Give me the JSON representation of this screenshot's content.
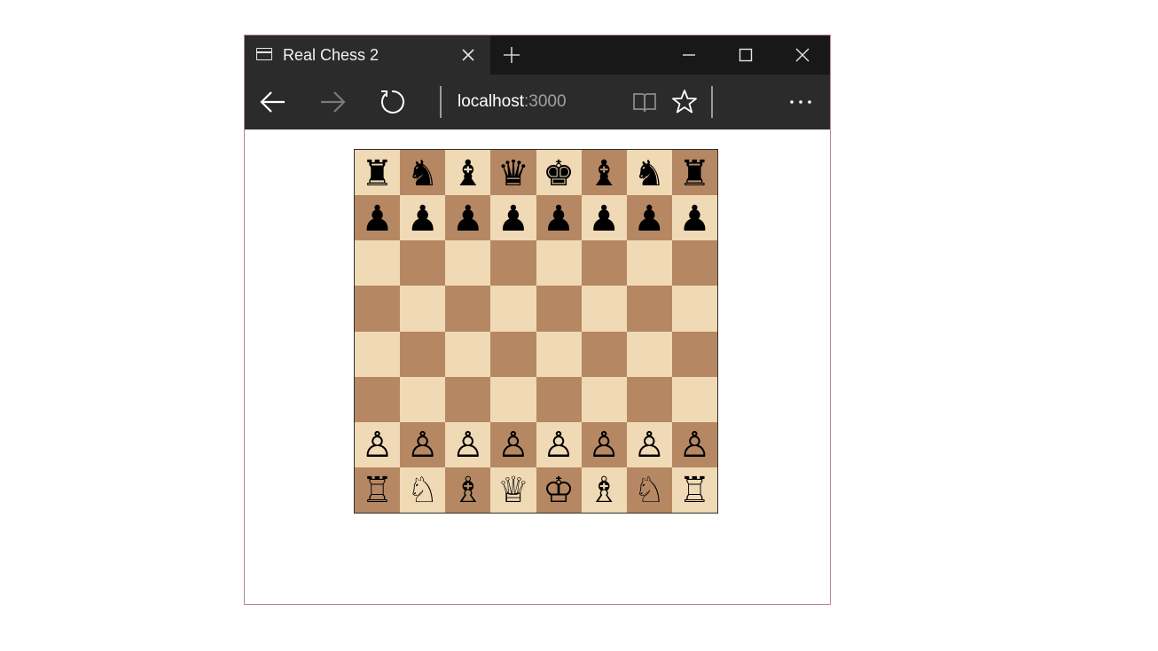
{
  "browser": {
    "tab_title": "Real Chess 2",
    "address_host": "localhost",
    "address_port": ":3000",
    "icons": {
      "tab": "tab-page-icon",
      "tab_close": "close-icon",
      "new_tab": "plus-icon",
      "minimize": "minimize-icon",
      "maximize": "maximize-icon",
      "close": "close-icon",
      "back": "arrow-left-icon",
      "forward": "arrow-right-icon",
      "refresh": "refresh-icon",
      "reading_view": "book-icon",
      "favorite": "star-icon",
      "more": "more-icon"
    },
    "colors": {
      "titlebar": "#181818",
      "toolbar": "#2b2b2b",
      "window_border": "#b9868a"
    }
  },
  "board": {
    "light_color": "#f0d9b5",
    "dark_color": "#b58863",
    "ranks": [
      [
        "♜",
        "♞",
        "♝",
        "♛",
        "♚",
        "♝",
        "♞",
        "♜"
      ],
      [
        "♟",
        "♟",
        "♟",
        "♟",
        "♟",
        "♟",
        "♟",
        "♟"
      ],
      [
        "",
        "",
        "",
        "",
        "",
        "",
        "",
        ""
      ],
      [
        "",
        "",
        "",
        "",
        "",
        "",
        "",
        ""
      ],
      [
        "",
        "",
        "",
        "",
        "",
        "",
        "",
        ""
      ],
      [
        "",
        "",
        "",
        "",
        "",
        "",
        "",
        ""
      ],
      [
        "♙",
        "♙",
        "♙",
        "♙",
        "♙",
        "♙",
        "♙",
        "♙"
      ],
      [
        "♖",
        "♘",
        "♗",
        "♕",
        "♔",
        "♗",
        "♘",
        "♖"
      ]
    ]
  }
}
